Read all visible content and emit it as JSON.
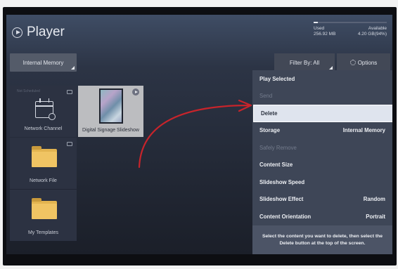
{
  "header": {
    "title": "Player",
    "storage": {
      "used_label": "Used",
      "used_value": "256.92 MB",
      "available_label": "Available",
      "available_value": "4.20 GB(94%)",
      "used_fraction": 0.06
    }
  },
  "toolbar": {
    "storage_select": "Internal Memory",
    "filter_label": "Filter By: All",
    "options_label": "Options"
  },
  "tiles": [
    {
      "label": "Network Channel",
      "faint_text": "Not Scheduled"
    },
    {
      "label": "Digital Signage Slideshow"
    },
    {
      "label": "Network File"
    },
    {
      "label": "My Templates"
    }
  ],
  "menu": {
    "items": [
      {
        "label": "Play Selected",
        "value": "",
        "state": "enabled"
      },
      {
        "label": "Send",
        "value": "",
        "state": "disabled"
      },
      {
        "label": "Delete",
        "value": "",
        "state": "selected"
      },
      {
        "label": "Storage",
        "value": "Internal Memory",
        "state": "enabled"
      },
      {
        "label": "Safely Remove",
        "value": "",
        "state": "disabled"
      },
      {
        "label": "Content Size",
        "value": "",
        "state": "enabled"
      },
      {
        "label": "Slideshow Speed",
        "value": "",
        "state": "enabled"
      },
      {
        "label": "Slideshow Effect",
        "value": "Random",
        "state": "enabled"
      },
      {
        "label": "Content Orientation",
        "value": "Portrait",
        "state": "enabled"
      }
    ],
    "help_text": "Select the content you want to delete, then select the Delete button at the top of the screen."
  },
  "colors": {
    "annotation_arrow": "#c8242b",
    "folder": "#f0c463",
    "menu_bg": "#3e4657",
    "selected_bg": "#dfe4ee"
  }
}
